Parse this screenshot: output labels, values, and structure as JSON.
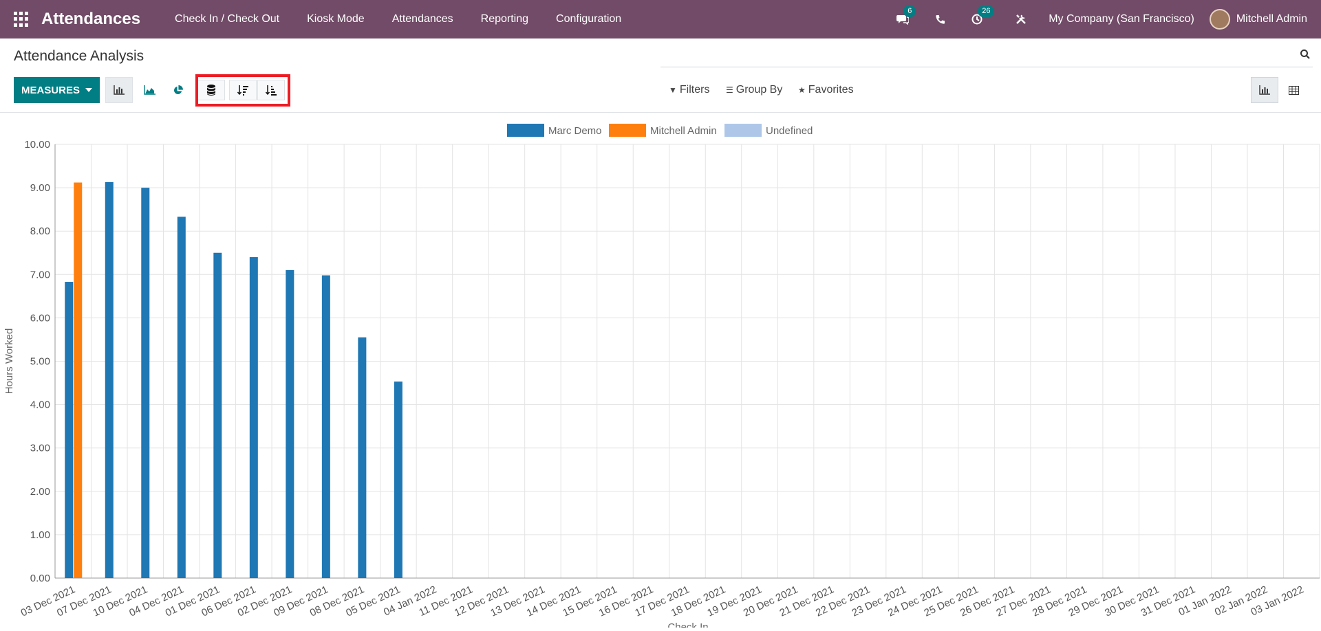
{
  "navbar": {
    "brand": "Attendances",
    "menu": [
      "Check In / Check Out",
      "Kiosk Mode",
      "Attendances",
      "Reporting",
      "Configuration"
    ],
    "messages_badge": "6",
    "activities_badge": "26",
    "company": "My Company (San Francisco)",
    "user": "Mitchell Admin"
  },
  "control_panel": {
    "title": "Attendance Analysis",
    "measures_label": "MEASURES",
    "filters_label": "Filters",
    "group_by_label": "Group By",
    "favorites_label": "Favorites"
  },
  "chart_data": {
    "type": "bar",
    "ylabel": "Hours Worked",
    "xlabel": "Check In",
    "ylim": [
      0,
      10
    ],
    "yticks": [
      "0.00",
      "1.00",
      "2.00",
      "3.00",
      "4.00",
      "5.00",
      "6.00",
      "7.00",
      "8.00",
      "9.00",
      "10.00"
    ],
    "legend_position": "top-center",
    "grid": true,
    "categories": [
      "03 Dec 2021",
      "07 Dec 2021",
      "10 Dec 2021",
      "04 Dec 2021",
      "01 Dec 2021",
      "06 Dec 2021",
      "02 Dec 2021",
      "09 Dec 2021",
      "08 Dec 2021",
      "05 Dec 2021",
      "04 Jan 2022",
      "11 Dec 2021",
      "12 Dec 2021",
      "13 Dec 2021",
      "14 Dec 2021",
      "15 Dec 2021",
      "16 Dec 2021",
      "17 Dec 2021",
      "18 Dec 2021",
      "19 Dec 2021",
      "20 Dec 2021",
      "21 Dec 2021",
      "22 Dec 2021",
      "23 Dec 2021",
      "24 Dec 2021",
      "25 Dec 2021",
      "26 Dec 2021",
      "27 Dec 2021",
      "28 Dec 2021",
      "29 Dec 2021",
      "30 Dec 2021",
      "31 Dec 2021",
      "01 Jan 2022",
      "02 Jan 2022",
      "03 Jan 2022"
    ],
    "series": [
      {
        "name": "Marc Demo",
        "color": "#1f77b4",
        "values": [
          6.83,
          9.13,
          9.0,
          8.33,
          7.5,
          7.4,
          7.1,
          6.98,
          5.55,
          4.53,
          0,
          0,
          0,
          0,
          0,
          0,
          0,
          0,
          0,
          0,
          0,
          0,
          0,
          0,
          0,
          0,
          0,
          0,
          0,
          0,
          0,
          0,
          0,
          0,
          0
        ]
      },
      {
        "name": "Mitchell Admin",
        "color": "#ff7f0e",
        "values": [
          9.12,
          0,
          0,
          0,
          0,
          0,
          0,
          0,
          0,
          0,
          0,
          0,
          0,
          0,
          0,
          0,
          0,
          0,
          0,
          0,
          0,
          0,
          0,
          0,
          0,
          0,
          0,
          0,
          0,
          0,
          0,
          0,
          0,
          0,
          0
        ]
      },
      {
        "name": "Undefined",
        "color": "#aec7e8",
        "values": [
          0,
          0,
          0,
          0,
          0,
          0,
          0,
          0,
          0,
          0,
          0,
          0,
          0,
          0,
          0,
          0,
          0,
          0,
          0,
          0,
          0,
          0,
          0,
          0,
          0,
          0,
          0,
          0,
          0,
          0,
          0,
          0,
          0,
          0,
          0
        ]
      }
    ]
  }
}
